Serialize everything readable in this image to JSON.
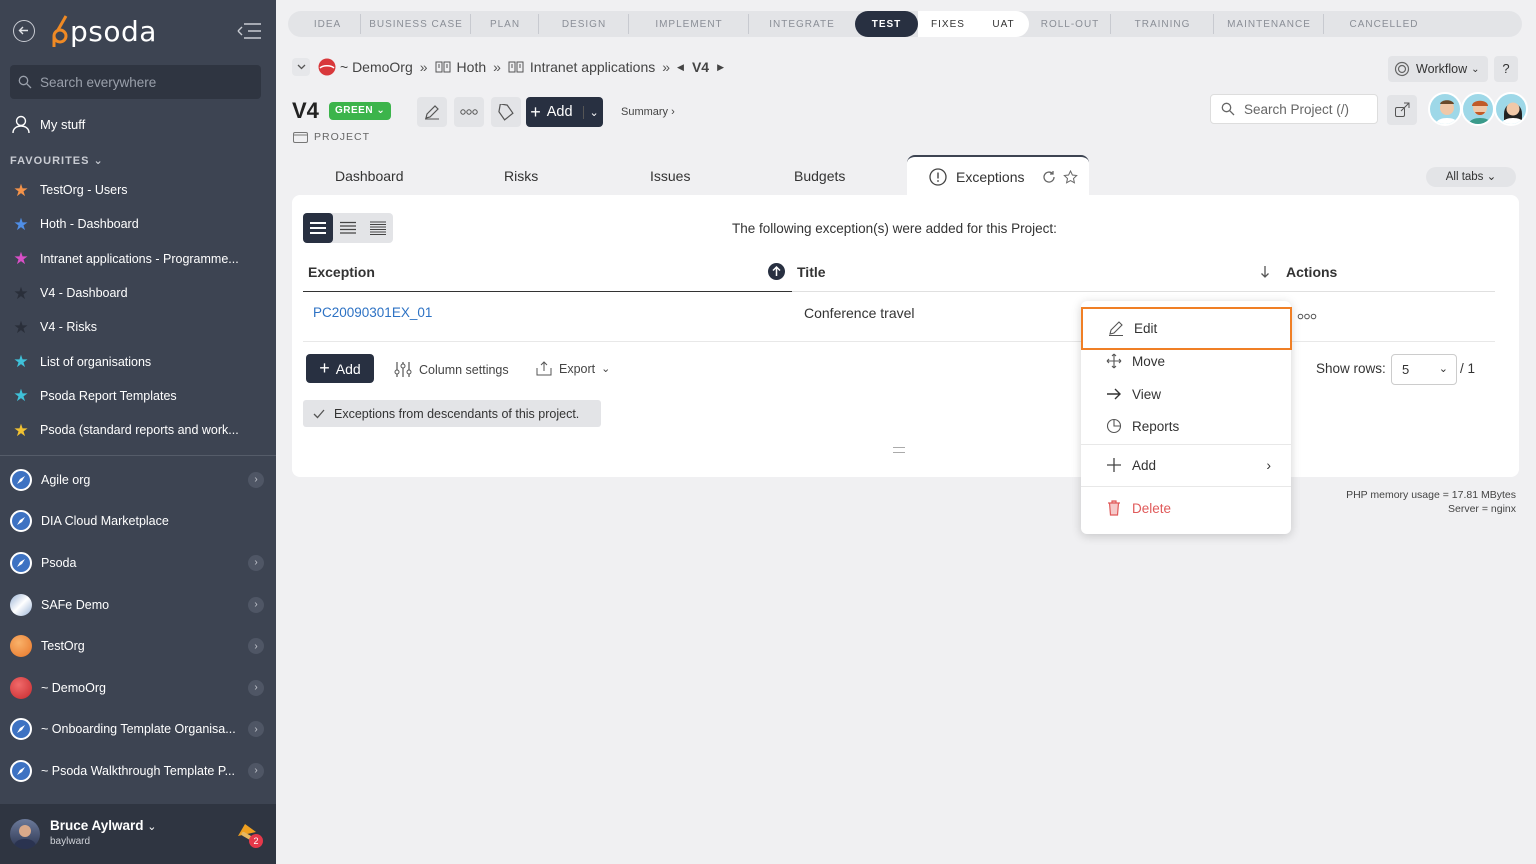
{
  "sidebar": {
    "logo": "psoda",
    "search_placeholder": "Search everywhere",
    "my_stuff": "My stuff",
    "favourites_heading": "FAVOURITES",
    "favourites": [
      {
        "label": "TestOrg - Users",
        "color": "#f4934a"
      },
      {
        "label": "Hoth - Dashboard",
        "color": "#4f8ee6"
      },
      {
        "label": "Intranet applications - Programme...",
        "color": "#d94fc7"
      },
      {
        "label": "V4 - Dashboard",
        "color": "#2a2f3a"
      },
      {
        "label": "V4 - Risks",
        "color": "#2a2f3a"
      },
      {
        "label": "List of organisations",
        "color": "#3fc1d9"
      },
      {
        "label": "Psoda Report Templates",
        "color": "#3fc1d9"
      },
      {
        "label": "Psoda (standard reports and work...",
        "color": "#f1c232"
      }
    ],
    "orgs": [
      {
        "label": "Agile org",
        "icon": "compass",
        "arrow": true
      },
      {
        "label": "DIA Cloud Marketplace",
        "icon": "compass",
        "arrow": false
      },
      {
        "label": "Psoda",
        "icon": "compass",
        "arrow": true
      },
      {
        "label": "SAFe Demo",
        "icon": "safe",
        "arrow": true
      },
      {
        "label": "TestOrg",
        "icon": "orange",
        "arrow": true
      },
      {
        "label": "~ DemoOrg",
        "icon": "red",
        "arrow": true
      },
      {
        "label": "~ Onboarding Template Organisa...",
        "icon": "compass",
        "arrow": true
      },
      {
        "label": "~ Psoda Walkthrough Template P...",
        "icon": "compass",
        "arrow": true
      }
    ],
    "user": {
      "name": "Bruce Aylward",
      "handle": "baylward",
      "notifications": "2"
    }
  },
  "stages": [
    {
      "label": "IDEA",
      "state": "past"
    },
    {
      "label": "BUSINESS CASE",
      "state": "past"
    },
    {
      "label": "PLAN",
      "state": "past"
    },
    {
      "label": "DESIGN",
      "state": "past"
    },
    {
      "label": "IMPLEMENT",
      "state": "past"
    },
    {
      "label": "INTEGRATE",
      "state": "past"
    },
    {
      "label": "TEST",
      "state": "active"
    },
    {
      "label": "FIXES",
      "state": "future"
    },
    {
      "label": "UAT",
      "state": "future"
    },
    {
      "label": "ROLL-OUT",
      "state": "past"
    },
    {
      "label": "TRAINING",
      "state": "past"
    },
    {
      "label": "MAINTENANCE",
      "state": "past"
    },
    {
      "label": "CANCELLED",
      "state": "past"
    }
  ],
  "breadcrumb": {
    "org": "~ DemoOrg",
    "programme": "Hoth",
    "project_group": "Intranet applications",
    "current": "V4"
  },
  "header": {
    "title": "V4",
    "status": "GREEN",
    "type_label": "PROJECT",
    "add_label": "Add",
    "summary_label": "Summary",
    "workflow_label": "Workflow",
    "help_label": "?",
    "search_placeholder": "Search Project (/)"
  },
  "tabs": [
    "Dashboard",
    "Risks",
    "Issues",
    "Budgets"
  ],
  "active_tab": "Exceptions",
  "all_tabs_label": "All tabs",
  "table": {
    "caption": "The following exception(s) were added for this Project:",
    "headers": {
      "exception": "Exception",
      "title": "Title",
      "actions": "Actions"
    },
    "rows": [
      {
        "exception": "PC20090301EX_01",
        "title": "Conference travel"
      }
    ],
    "add_label": "Add",
    "column_settings_label": "Column settings",
    "export_label": "Export",
    "descendants_label": "Exceptions from descendants of this project.",
    "show_rows_label": "Show rows:",
    "rows_value": "5",
    "page_count": "/ 1"
  },
  "context_menu": {
    "edit": "Edit",
    "move": "Move",
    "view": "View",
    "reports": "Reports",
    "add": "Add",
    "delete": "Delete"
  },
  "footer": {
    "memory": "PHP memory usage = 17.81 MBytes",
    "server": "Server = nginx"
  }
}
